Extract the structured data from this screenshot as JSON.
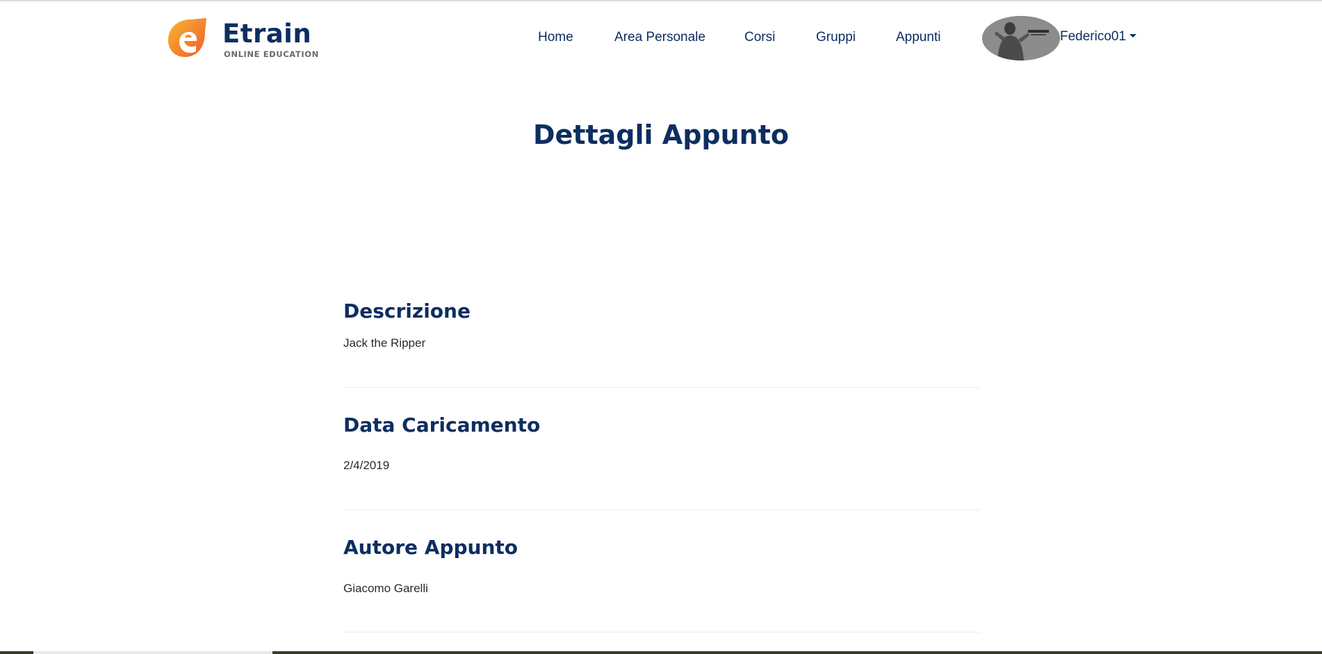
{
  "brand": {
    "name": "Etrain",
    "tagline": "ONLINE EDUCATION",
    "colors": {
      "primary": "#0c2e60",
      "logo_orange": "#f7931e",
      "logo_red": "#f15a29"
    }
  },
  "nav": {
    "items": [
      {
        "label": "Home"
      },
      {
        "label": "Area Personale"
      },
      {
        "label": "Corsi"
      },
      {
        "label": "Gruppi"
      },
      {
        "label": "Appunti"
      }
    ],
    "user": {
      "name": "Federico01",
      "avatar_icon": "user-avatar-photo",
      "menu_icon": "caret-down-icon"
    }
  },
  "page": {
    "title": "Dettagli Appunto"
  },
  "sections": [
    {
      "title": "Descrizione",
      "value": "Jack the Ripper"
    },
    {
      "title": "Data Caricamento",
      "value": "2/4/2019"
    },
    {
      "title": "Autore Appunto",
      "value": "Giacomo Garelli"
    }
  ]
}
